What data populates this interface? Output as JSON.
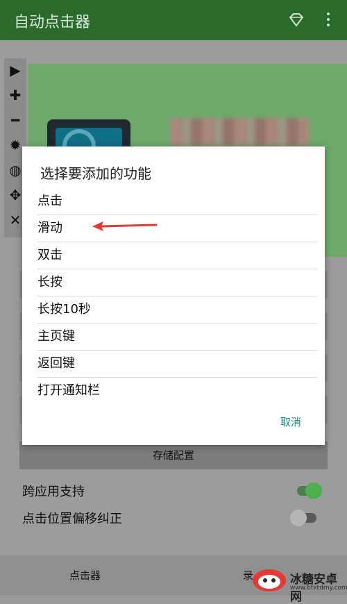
{
  "app": {
    "title": "自动点击器",
    "actions": [
      "diamond-icon",
      "more-vert-icon"
    ]
  },
  "floating_toolbar": {
    "tools": [
      "play-icon",
      "plus-icon",
      "minus-icon",
      "settings-icon",
      "eye-off-icon",
      "move-icon",
      "close-icon"
    ]
  },
  "main": {
    "store_config_label": "存储配置",
    "settings": [
      {
        "label": "跨应用支持",
        "enabled": true
      },
      {
        "label": "点击位置偏移纠正",
        "enabled": false
      }
    ]
  },
  "bottom_nav": {
    "tabs": [
      "点击器",
      "录"
    ]
  },
  "dialog": {
    "title": "选择要添加的功能",
    "options": [
      "点击",
      "滑动",
      "双击",
      "长按",
      "长按10秒",
      "主页键",
      "返回键",
      "打开通知栏"
    ],
    "cancel_label": "取消"
  },
  "watermark": {
    "name": "冰糖安卓网",
    "url": "www.btxtdmy.com"
  },
  "colors": {
    "appbar": "#2a6b2c",
    "accent": "#1b8f7a",
    "annotation_arrow": "#e53935",
    "toggle_on": "#4caf50"
  }
}
